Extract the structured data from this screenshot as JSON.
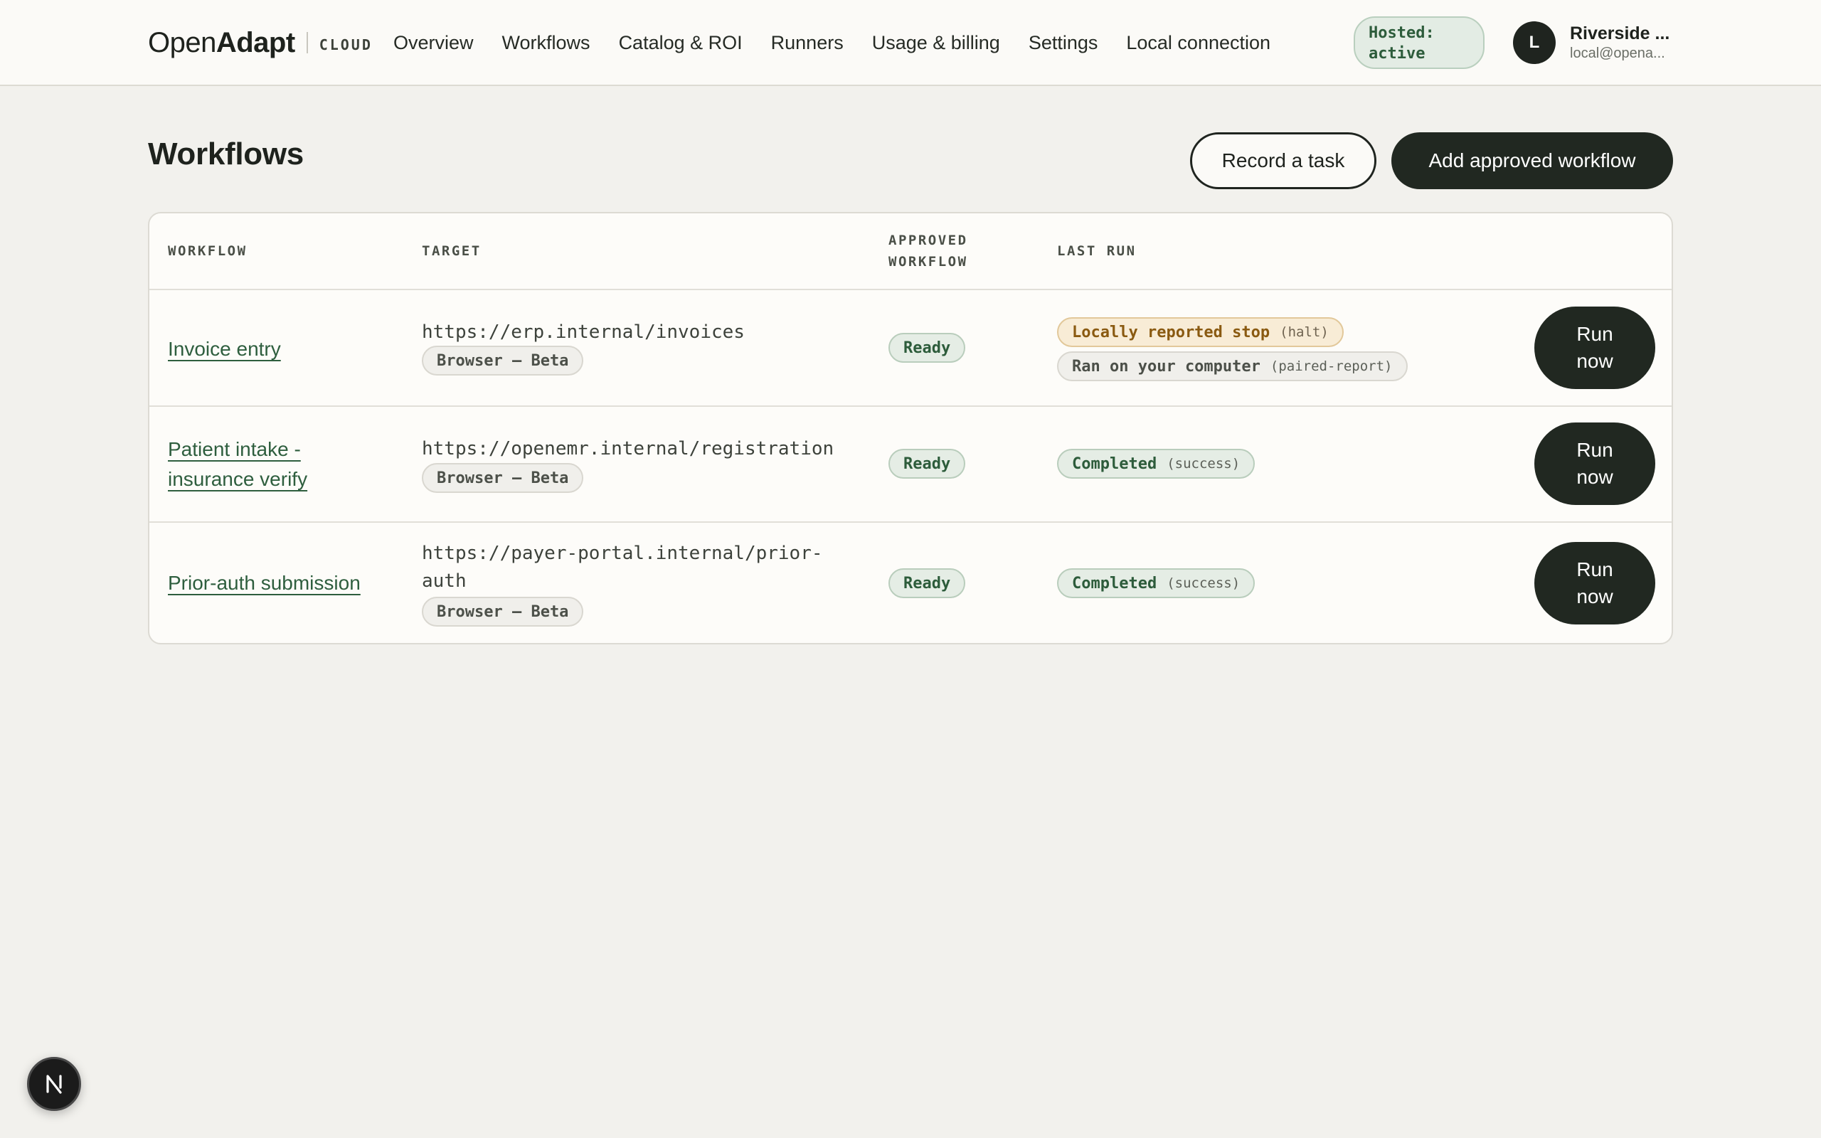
{
  "header": {
    "brand_open": "Open",
    "brand_adapt": "Adapt",
    "brand_cloud": "CLOUD",
    "nav": [
      "Overview",
      "Workflows",
      "Catalog & ROI",
      "Runners",
      "Usage & billing",
      "Settings",
      "Local connection"
    ],
    "hosted_badge": "Hosted: active",
    "account": {
      "initial": "L",
      "name": "Riverside ...",
      "email": "local@opena..."
    }
  },
  "page": {
    "title": "Workflows",
    "record_button": "Record a task",
    "add_button": "Add approved workflow"
  },
  "table": {
    "columns": {
      "workflow": "WORKFLOW",
      "target": "TARGET",
      "approved_line1": "APPROVED",
      "approved_line2": "WORKFLOW",
      "last_run": "LAST RUN"
    },
    "rows": [
      {
        "name": "Invoice entry",
        "url": "https://erp.internal/invoices",
        "target_tag": "Browser — Beta",
        "approved": "Ready",
        "last_run": [
          {
            "label": "Locally reported stop",
            "detail": "(halt)",
            "tone": "amber"
          },
          {
            "label": "Ran on your computer",
            "detail": "(paired-report)",
            "tone": "gray"
          }
        ],
        "run_button": "Run now"
      },
      {
        "name": "Patient intake - insurance verify",
        "url": "https://openemr.internal/registration",
        "target_tag": "Browser — Beta",
        "approved": "Ready",
        "last_run": [
          {
            "label": "Completed",
            "detail": "(success)",
            "tone": "green"
          }
        ],
        "run_button": "Run now"
      },
      {
        "name": "Prior-auth submission",
        "url": "https://payer-portal.internal/prior-auth",
        "target_tag": "Browser — Beta",
        "approved": "Ready",
        "last_run": [
          {
            "label": "Completed",
            "detail": "(success)",
            "tone": "green"
          }
        ],
        "run_button": "Run now"
      }
    ]
  },
  "fab": {
    "letter": "N",
    "icon": "nextjs-logo-icon"
  },
  "colors": {
    "background": "#f2f1ed",
    "header_bg": "#fbfaf7",
    "primary_dark": "#212821",
    "link_green": "#2e5e3e",
    "status_green_bg": "#e5ede5",
    "status_amber_bg": "#f8ecd6"
  }
}
